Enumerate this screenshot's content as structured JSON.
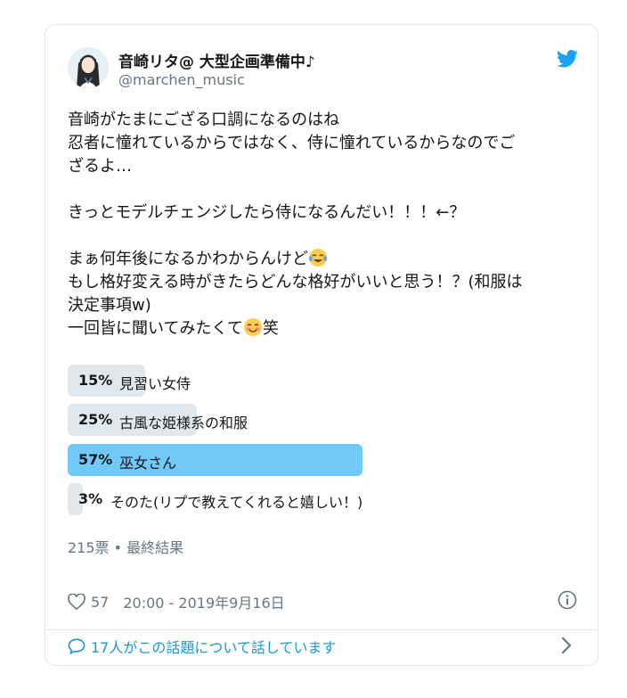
{
  "user": {
    "display_name": "音崎リタ@ 大型企画準備中♪",
    "handle": "@marchen_music",
    "avatar_icon": "profile-avatar"
  },
  "tweet": {
    "lines": [
      "音崎がたまにござる口調になるのはね",
      "忍者に憧れているからではなく、侍に憧れているからなのでご",
      "ざるよ…",
      "",
      "きっとモデルチェンジしたら侍になるんだい！！！←？",
      "",
      "まぁ何年後になるかわからんけど",
      "もし格好変える時がきたらどんな格好がいいと思う！？(和服は",
      "決定事項w)",
      "一回皆に聞いてみたくて",
      "笑"
    ],
    "emoji_tears": "tears-of-joy-emoji",
    "emoji_blush": "smiling-blush-emoji"
  },
  "poll": {
    "options": [
      {
        "percent": 15,
        "percent_label": "15%",
        "label": "見習い女侍"
      },
      {
        "percent": 25,
        "percent_label": "25%",
        "label": "古風な姫様系の和服"
      },
      {
        "percent": 57,
        "percent_label": "57%",
        "label": "巫女さん",
        "winner": true
      },
      {
        "percent": 3,
        "percent_label": "3%",
        "label": "そのた(リプで教えてくれると嬉しい！)"
      }
    ],
    "summary": "215票 • 最終結果",
    "win_color": "#71c9f8",
    "bar_color": "#e1e8ed"
  },
  "footer": {
    "likes": "57",
    "timestamp": "20:00 - 2019年9月16日",
    "replies_text": "17人がこの話題について話しています"
  },
  "colors": {
    "twitter_blue": "#1da1f2",
    "link_blue": "#1b95e0",
    "muted": "#657786"
  }
}
